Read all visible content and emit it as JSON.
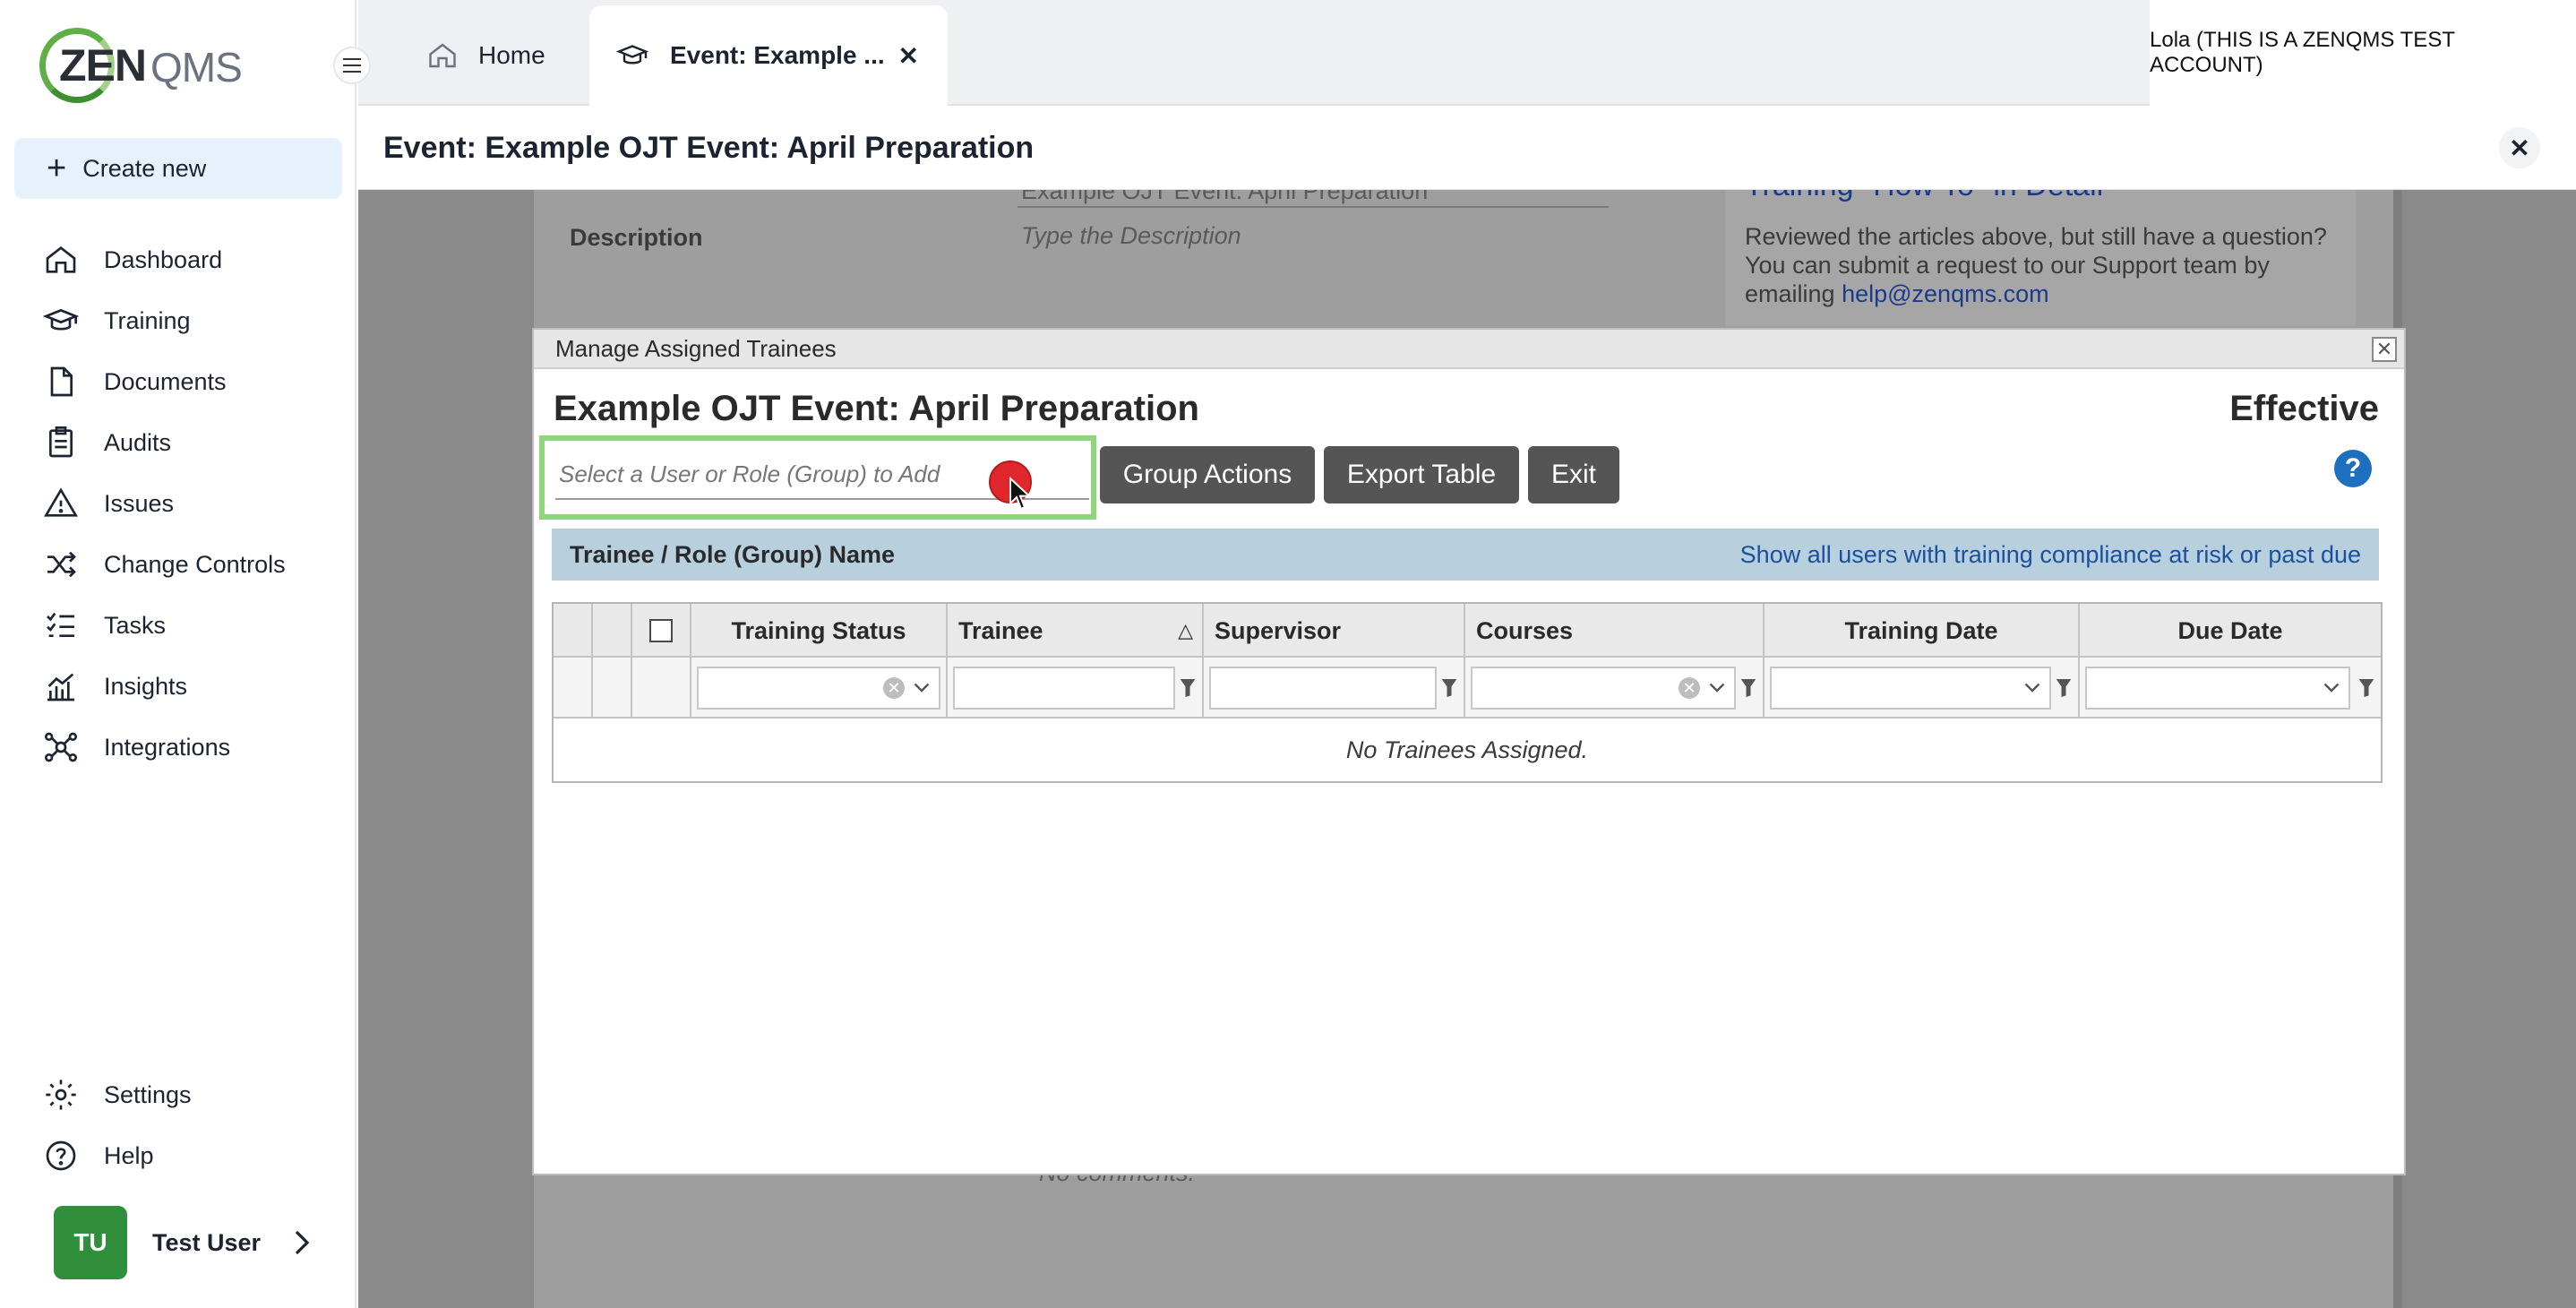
{
  "brand": {
    "logo_zen": "ZEN",
    "logo_qms": "QMS"
  },
  "sidebar": {
    "create_new": "Create new",
    "items": [
      {
        "label": "Dashboard",
        "icon": "home-icon"
      },
      {
        "label": "Training",
        "icon": "graduation-cap-icon"
      },
      {
        "label": "Documents",
        "icon": "document-icon"
      },
      {
        "label": "Audits",
        "icon": "clipboard-icon"
      },
      {
        "label": "Issues",
        "icon": "warning-icon"
      },
      {
        "label": "Change Controls",
        "icon": "shuffle-icon"
      },
      {
        "label": "Tasks",
        "icon": "checklist-icon"
      },
      {
        "label": "Insights",
        "icon": "chart-icon"
      },
      {
        "label": "Integrations",
        "icon": "network-icon"
      }
    ],
    "bottom_items": [
      {
        "label": "Settings",
        "icon": "gear-icon"
      },
      {
        "label": "Help",
        "icon": "question-icon"
      }
    ],
    "user": {
      "initials": "TU",
      "name": "Test User"
    }
  },
  "topbar": {
    "tabs": [
      {
        "label": "Home",
        "icon": "home-icon"
      },
      {
        "label": "Event: Example ...",
        "icon": "graduation-cap-icon",
        "active": true
      }
    ],
    "account": "Lola (THIS IS A ZENQMS TEST ACCOUNT)"
  },
  "page": {
    "title": "Event: Example OJT Event: April Preparation",
    "background": {
      "top_field_value": "Example OJT Event: April Preparation",
      "description_label": "Description",
      "description_placeholder": "Type the Description",
      "help_title": "Training \"How To\" in Detail",
      "help_text": "Reviewed the articles above, but still have a question? You can submit a request to our Support team by emailing",
      "help_email": "help@zenqms.com",
      "comments": "No comments."
    }
  },
  "modal": {
    "window_title": "Manage Assigned Trainees",
    "title": "Example OJT Event: April Preparation",
    "status": "Effective",
    "add_placeholder": "Select a User or Role (Group) to Add",
    "buttons": {
      "group_actions": "Group Actions",
      "export_table": "Export Table",
      "exit": "Exit"
    },
    "group_bar": {
      "label": "Trainee / Role (Group) Name",
      "link": "Show all users with training compliance at risk or past due"
    },
    "columns": [
      "Training Status",
      "Trainee",
      "Supervisor",
      "Courses",
      "Training Date",
      "Due Date"
    ],
    "sort_indicator": "△",
    "empty_message": "No Trainees Assigned."
  },
  "colors": {
    "accent": "#e6f1fb",
    "highlight_border": "#8fd67b",
    "button_bg": "#555555",
    "group_bar_bg": "#b8d0de",
    "avatar_bg": "#2f8f3a"
  }
}
